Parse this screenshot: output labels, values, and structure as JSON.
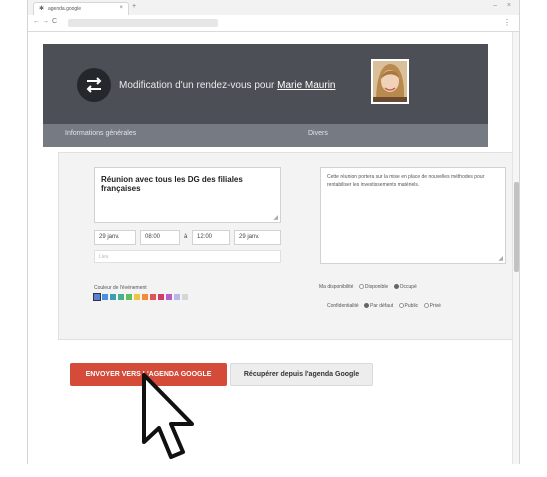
{
  "browser": {
    "tab_title": "agenda.google",
    "tab_close": "×",
    "new_tab": "+",
    "minimize": "–",
    "close": "×",
    "back": "←",
    "forward": "→",
    "reload": "C",
    "menu": "⋮"
  },
  "header": {
    "title_prefix": "Modification d'un rendez-vous pour ",
    "person_name": "Marie Maurin"
  },
  "subheader": {
    "left": "Informations générales",
    "right": "Divers"
  },
  "form": {
    "subject": "Réunion avec tous les DG des filiales françaises",
    "description": "Cette réunion portera sur la mise en place de nouvelles méthodes pour rentabiliser les investissements matériels.",
    "start_date": "29 janv.",
    "start_time": "08:00",
    "time_sep": "à",
    "end_time": "12:00",
    "end_date": "29 janv.",
    "location_placeholder": "Lieu",
    "color_label": "Couleur de l'événement",
    "availability_label": "Ma disponibilité",
    "availability_options": [
      "Disponible",
      "Occupé"
    ],
    "confidentiality_label": "Confidentialité",
    "confidentiality_options": [
      "Par défaut",
      "Public",
      "Privé"
    ]
  },
  "colors": [
    "#5a7fd6",
    "#4f8fe0",
    "#3f9cb2",
    "#48b08c",
    "#5fbf5f",
    "#f0c340",
    "#f28a3a",
    "#e05555",
    "#d23c64",
    "#b65fc8",
    "#b8b8e6",
    "#d6d6d6"
  ],
  "actions": {
    "send_label": "ENVOYER VERS L'AGENDA GOOGLE",
    "fetch_label": "Récupérer depuis l'agenda Google"
  },
  "accent": "#d44b3a"
}
